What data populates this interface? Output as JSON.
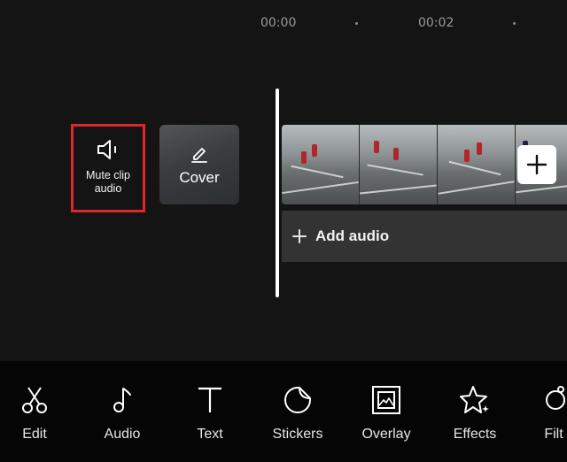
{
  "timeline": {
    "time_markers": [
      "00:00",
      "00:02"
    ]
  },
  "mute_clip": {
    "label": "Mute clip audio",
    "icon": "speaker-icon",
    "highlight_color": "#e0262a"
  },
  "cover": {
    "label": "Cover",
    "icon": "pencil-icon"
  },
  "clip": {
    "add_button_icon": "plus-icon"
  },
  "audio_track": {
    "label": "Add audio",
    "icon": "plus-icon"
  },
  "toolbar": {
    "items": [
      {
        "label": "Edit",
        "icon": "scissors-icon"
      },
      {
        "label": "Audio",
        "icon": "music-note-icon"
      },
      {
        "label": "Text",
        "icon": "text-icon"
      },
      {
        "label": "Stickers",
        "icon": "sticker-icon"
      },
      {
        "label": "Overlay",
        "icon": "overlay-icon"
      },
      {
        "label": "Effects",
        "icon": "effects-star-icon"
      },
      {
        "label": "Filt",
        "icon": "filter-icon"
      }
    ]
  }
}
